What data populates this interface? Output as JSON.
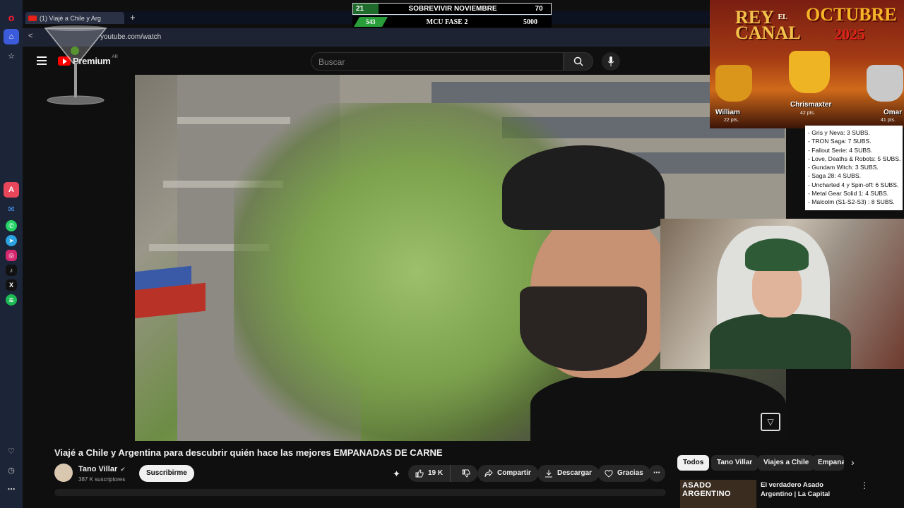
{
  "browser": {
    "tab_title": "(1) Viajé a Chile y Arg",
    "new_tab": "+",
    "url": "youtube.com/watch",
    "back": "<"
  },
  "youtube": {
    "logo_text": "Premium",
    "logo_country": "AR",
    "search_placeholder": "Buscar"
  },
  "video": {
    "title": "Viajé a Chile y Argentina para descubrir quién hace las mejores EMPANADAS DE CARNE",
    "channel_name": "Tano Villar",
    "verified": "✔",
    "subscribers": "387 K suscriptores",
    "subscribe_label": "Suscribirme",
    "likes": "19 K",
    "share_label": "Compartir",
    "download_label": "Descargar",
    "thanks_label": "Gracias",
    "more_label": "⋯"
  },
  "chips": {
    "todos": "Todos",
    "tano": "Tano Villar",
    "viajes": "Viajes a Chile",
    "empanadas": "Empanadas",
    "next": "›"
  },
  "recommendation": {
    "thumb_text": "ASADO ARGENTINO",
    "title": "El verdadero Asado Argentino | La Capital",
    "more": "⋮"
  },
  "overlay": {
    "score_left": "21",
    "score_title": "SOBREVIVIR NOVIEMBRE",
    "score_right": "70",
    "mcu_left": "543",
    "mcu_title": "MCU FASE 2",
    "mcu_right": "5000",
    "rey_title_1": "REY",
    "rey_el": "EL",
    "rey_title_2": "CANAL",
    "rey_month": "OCTUBRE",
    "rey_year": "2025",
    "rank1_name": "Chrismaxter",
    "rank1_pts": "42 pts.",
    "rank2_name": "William",
    "rank2_pts": "22 pts.",
    "rank3_name": "Omar",
    "rank3_pts": "41 pts."
  },
  "subs_list": [
    "- Gris y Neva: 3 SUBS.",
    "- TRON Saga: 7 SUBS.",
    "- Fallout Serie: 4 SUBS.",
    "- Love, Deaths & Robots: 5 SUBS.",
    "- Gundam Witch: 3 SUBS.",
    "- Saga 28: 4 SUBS.",
    "- Uncharted 4 y Spin-off: 6 SUBS.",
    "- Metal Gear Solid 1: 4 SUBS.",
    "- Malcolm (S1-S2-S3) : 8 SUBS."
  ],
  "colors": {
    "background": "#0f0f0f",
    "sidebar": "#1c2538",
    "youtube_red": "#ff0000",
    "score_green": "#1f6b2b",
    "banner_orange": "#d06a1a"
  },
  "icons": {
    "sidebar": [
      "opera-logo-icon",
      "home-icon",
      "star-icon",
      "aria-icon",
      "messenger-icon",
      "whatsapp-icon",
      "telegram-icon",
      "instagram-icon",
      "tiktok-icon",
      "x-icon",
      "spotify-icon",
      "heart-icon",
      "history-icon",
      "more-icon"
    ]
  }
}
